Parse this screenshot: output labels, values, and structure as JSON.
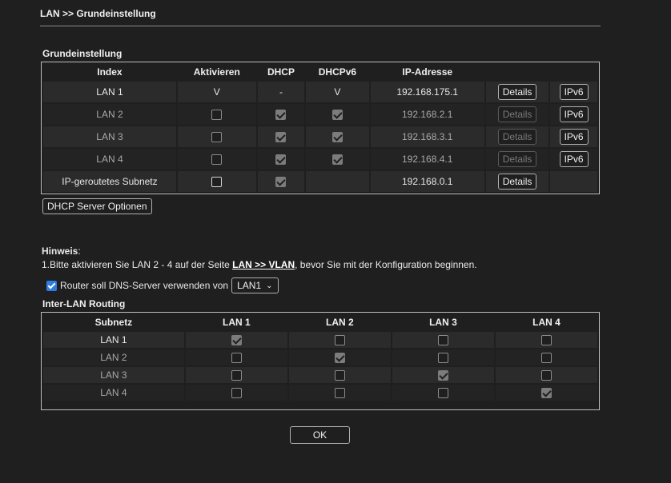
{
  "page": {
    "title": "LAN >> Grundeinstellung"
  },
  "grund": {
    "section_title": "Grundeinstellung",
    "headers": [
      "Index",
      "Aktivieren",
      "DHCP",
      "DHCPv6",
      "IP-Adresse",
      "",
      ""
    ],
    "details_label": "Details",
    "ipv6_label": "IPv6",
    "rows": [
      {
        "index": "LAN 1",
        "aktivieren": "V",
        "dhcp": "-",
        "dhcpv6": "V",
        "ip": "192.168.175.1"
      },
      {
        "index": "LAN 2",
        "ip": "192.168.2.1"
      },
      {
        "index": "LAN 3",
        "ip": "192.168.3.1"
      },
      {
        "index": "LAN 4",
        "ip": "192.168.4.1"
      },
      {
        "index": "IP-geroutetes Subnetz",
        "ip": "192.168.0.1"
      }
    ],
    "dhcp_options_button": "DHCP Server Optionen"
  },
  "hinweis": {
    "label": "Hinweis",
    "colon": ":",
    "line_prefix": "1.Bitte aktivieren Sie LAN 2 - 4 auf der Seite ",
    "link": "LAN >> VLAN",
    "line_suffix": ", bevor Sie mit der Konfiguration beginnen."
  },
  "dns": {
    "label": "Router soll DNS-Server verwenden von",
    "selected": "LAN1",
    "checked": true
  },
  "inter": {
    "section_title": "Inter-LAN Routing",
    "headers": [
      "Subnetz",
      "LAN 1",
      "LAN 2",
      "LAN 3",
      "LAN 4"
    ],
    "rows": [
      {
        "label": "LAN 1",
        "checks": [
          true,
          false,
          false,
          false
        ]
      },
      {
        "label": "LAN 2",
        "checks": [
          false,
          true,
          false,
          false
        ]
      },
      {
        "label": "LAN 3",
        "checks": [
          false,
          false,
          true,
          false
        ]
      },
      {
        "label": "LAN 4",
        "checks": [
          false,
          false,
          false,
          true
        ]
      }
    ]
  },
  "ok_label": "OK"
}
